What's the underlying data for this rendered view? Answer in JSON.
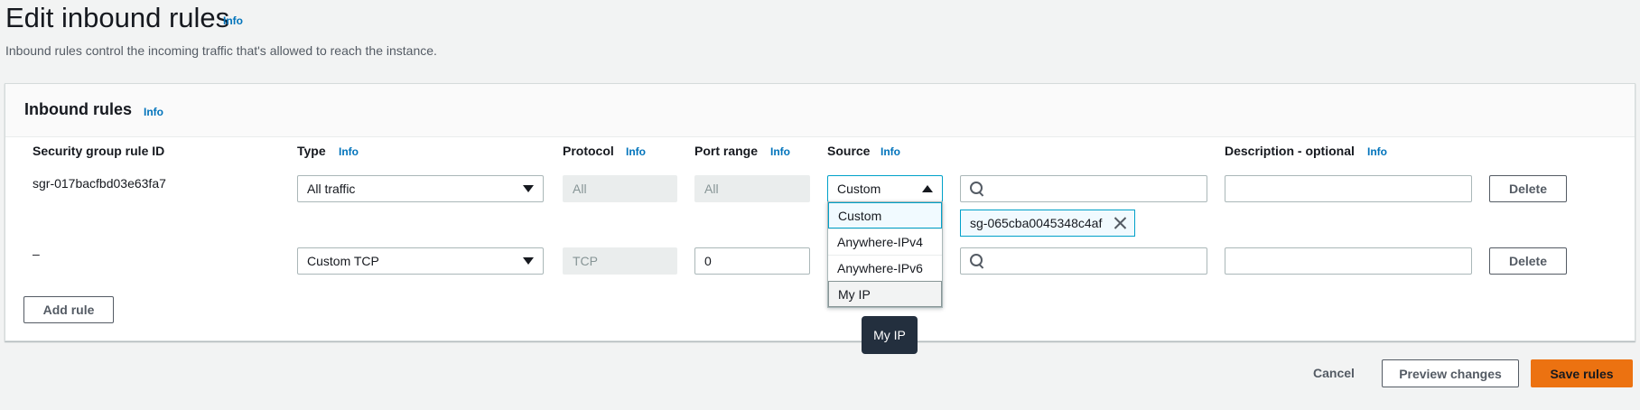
{
  "page": {
    "title": "Edit inbound rules",
    "title_info": "Info",
    "description": "Inbound rules control the incoming traffic that's allowed to reach the instance."
  },
  "panel": {
    "title": "Inbound rules",
    "title_info": "Info",
    "columns": {
      "rule_id": "Security group rule ID",
      "type": "Type",
      "type_info": "Info",
      "protocol": "Protocol",
      "protocol_info": "Info",
      "port_range": "Port range",
      "port_range_info": "Info",
      "source": "Source",
      "source_info": "Info",
      "description": "Description - optional",
      "description_info": "Info"
    },
    "rows": [
      {
        "rule_id": "sgr-017bacfbd03e63fa7",
        "type": "All traffic",
        "protocol": "All",
        "port_range": "All",
        "source": "Custom",
        "search_value": "",
        "token": "sg-065cba0045348c4af",
        "description": "",
        "delete_label": "Delete"
      },
      {
        "rule_id": "–",
        "type": "Custom TCP",
        "protocol": "TCP",
        "port_range": "0",
        "source": "",
        "search_value": "",
        "description": "",
        "delete_label": "Delete"
      }
    ],
    "add_rule_label": "Add rule"
  },
  "source_dropdown": {
    "options": [
      "Custom",
      "Anywhere-IPv4",
      "Anywhere-IPv6",
      "My IP"
    ],
    "selected": "Custom",
    "hovered": "My IP"
  },
  "tooltip": {
    "text": "My IP"
  },
  "footer": {
    "cancel_label": "Cancel",
    "preview_label": "Preview changes",
    "save_label": "Save rules"
  },
  "colors": {
    "accent": "#ec7211",
    "link": "#0073bb",
    "selected_border": "#00a1c9"
  }
}
